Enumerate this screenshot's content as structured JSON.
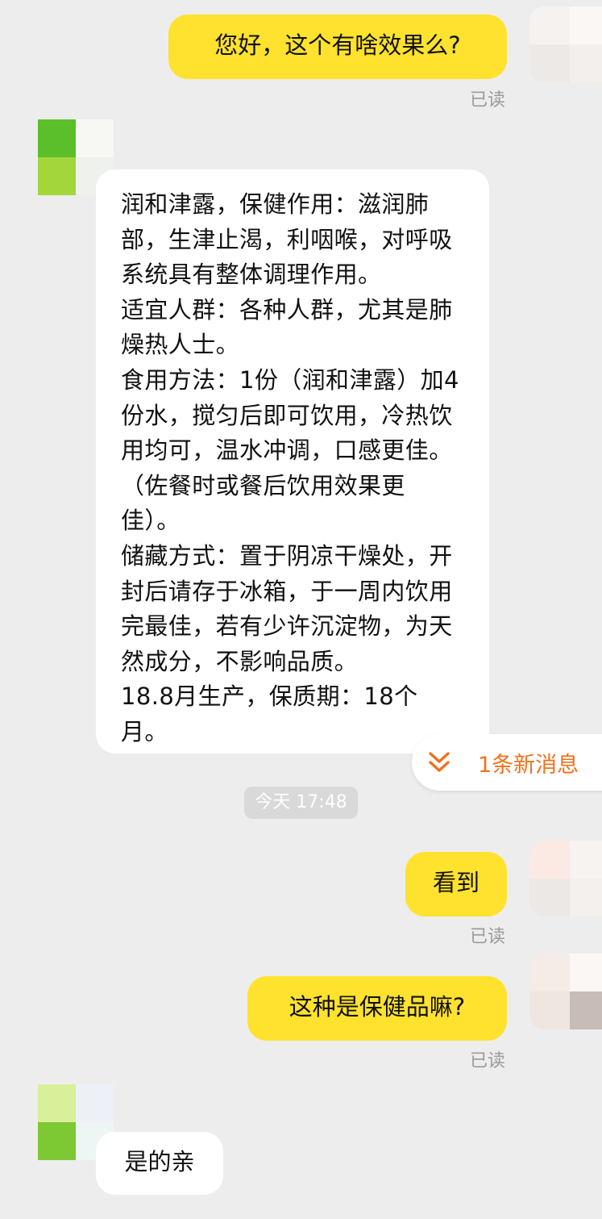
{
  "messages": {
    "m1": {
      "text": "您好，这个有啥效果么?",
      "status": "已读"
    },
    "m2": {
      "lines": [
        "润和津露，保健作用：滋润肺部，生津止渴，利咽喉，对呼吸系统具有整体调理作用。",
        "适宜人群：各种人群，尤其是肺燥热人士。",
        "食用方法：1份（润和津露）加4份水，搅匀后即可饮用，冷热饮用均可，温水冲调，口感更佳。（佐餐时或餐后饮用效果更佳）。",
        "储藏方式：置于阴凉干燥处，开封后请存于冰箱，于一周内饮用完最佳，若有少许沉淀物，为天然成分，不影响品质。",
        "18.8月生产，保质期：18个月。"
      ]
    },
    "timestamp": "今天 17:48",
    "m3": {
      "text": "看到",
      "status": "已读"
    },
    "m4": {
      "text": "这种是保健品嘛?",
      "status": "已读"
    },
    "m5": {
      "text": "是的亲"
    }
  },
  "new_message_pill": {
    "label": "1条新消息",
    "icon": "double-chevron-down-icon",
    "color": "#f2711c"
  },
  "colors": {
    "background": "#ededed",
    "outgoing_bubble": "#ffe22e",
    "incoming_bubble": "#ffffff"
  }
}
